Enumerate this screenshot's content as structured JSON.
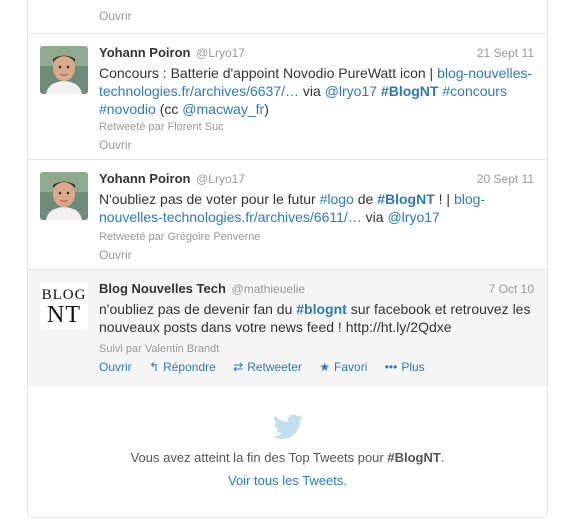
{
  "top_fragment": {
    "open_label": "Ouvrir"
  },
  "tweets": [
    {
      "fullname": "Yohann Poiron",
      "screen_name": "@Lryo17",
      "time": "21 Sept 11",
      "text": {
        "t1": "Concours : Batterie d'appoint Novodio PureWatt icon | ",
        "link1": "blog-nouvelles-technologies.fr/archives/6637/…",
        "t2": " via ",
        "mention1": "@lryo17",
        "hash1": "#BlogNT",
        "hash2": "#concours",
        "hash3": "#novodio",
        "t3": " (cc ",
        "mention2": "@macway_fr",
        "t4": ")"
      },
      "context": "Retweeté par Florent Suc",
      "open_label": "Ouvrir"
    },
    {
      "fullname": "Yohann Poiron",
      "screen_name": "@Lryo17",
      "time": "20 Sept 11",
      "text": {
        "t1": "N'oubliez pas de voter pour le futur ",
        "hash1": "#logo",
        "t2": " de ",
        "hash2": "#BlogNT",
        "t3": " ! | ",
        "link1": "blog-nouvelles-technologies.fr/archives/6611/…",
        "t4": " via ",
        "mention1": "@lryo17"
      },
      "context": "Retweeté par Grégoire Penverne",
      "open_label": "Ouvrir"
    },
    {
      "fullname": "Blog Nouvelles Tech",
      "screen_name": "@mathieuelie",
      "time": "7 Oct 10",
      "avatar_line1": "BLOG",
      "avatar_line2": "NT",
      "text": {
        "t1": "n'oubliez pas de devenir fan du ",
        "hash1": "#blognt",
        "t2": " sur facebook et retrouvez les nouveaux posts dans votre news feed ! http://ht.ly/2Qdxe"
      },
      "context": "Suivi par Valentin Brandt",
      "actions": {
        "open": "Ouvrir",
        "reply": "Répondre",
        "retweet": "Retweeter",
        "favorite": "Favori",
        "more": "Plus"
      }
    }
  ],
  "end": {
    "msg_prefix": "Vous avez atteint la fin des Top Tweets pour ",
    "msg_hash": "#BlogNT",
    "msg_suffix": ".",
    "link": "Voir tous les Tweets."
  },
  "colors": {
    "link": "#2b7bb9",
    "muted": "#999999",
    "text": "#333333",
    "icon": "#c0deed"
  }
}
